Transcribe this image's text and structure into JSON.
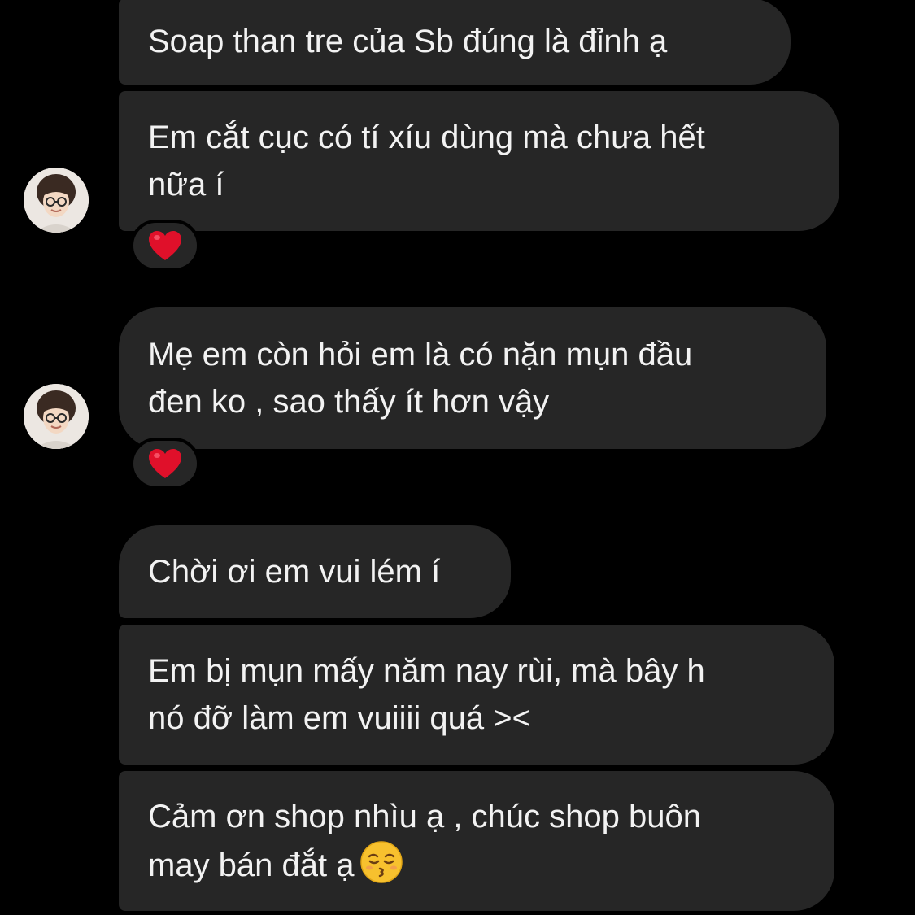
{
  "messages": [
    {
      "lines": [
        "Soap than tre của Sb đúng là đỉnh ạ"
      ]
    },
    {
      "lines": [
        "Em cắt cục có tí xíu dùng mà chưa hết",
        "nữa í"
      ],
      "reaction": "heart-emoji"
    },
    {
      "lines": [
        "Mẹ em còn hỏi em là có nặn mụn đầu",
        "đen ko , sao thấy ít hơn vậy"
      ],
      "reaction": "heart-emoji"
    },
    {
      "lines": [
        "Chời ơi em vui lém í"
      ]
    },
    {
      "lines": [
        "Em bị mụn mấy năm nay rùi, mà bây h",
        "nó đỡ làm em vuiiii quá ><"
      ]
    },
    {
      "lines": [
        "Cảm ơn shop nhìu ạ , chúc shop buôn",
        "may bán đắt ạ"
      ],
      "trailing_emoji": "kissing-face-emoji"
    }
  ],
  "colors": {
    "background": "#000000",
    "bubble": "#262626",
    "text": "#f2f2f2",
    "heart": "#e0102a"
  }
}
